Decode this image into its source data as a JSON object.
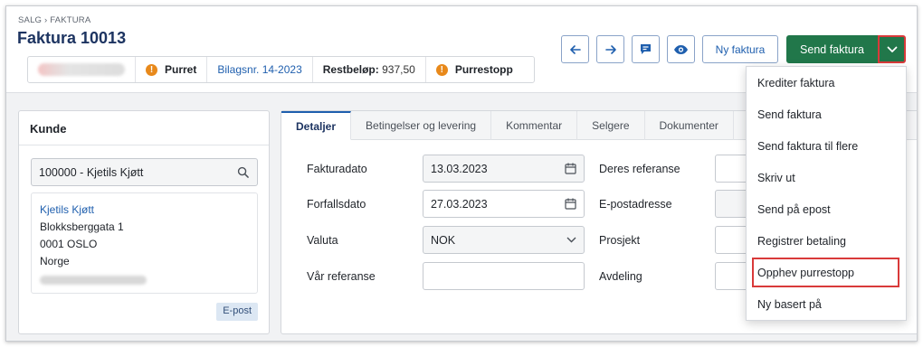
{
  "breadcrumb": "SALG › FAKTURA",
  "title": "Faktura 10013",
  "status": {
    "state": "Purret",
    "bilagsnr": "Bilagsnr. 14-2023",
    "restbelop_label": "Restbeløp:",
    "restbelop_value": "937,50",
    "purrestopp": "Purrestopp",
    "warn_color": "#e8891b"
  },
  "toolbar": {
    "prev_icon": "arrow-left-icon",
    "next_icon": "arrow-right-icon",
    "comment_icon": "comment-icon",
    "preview_icon": "eye-icon",
    "ny_faktura": "Ny faktura",
    "send_faktura": "Send faktura",
    "caret_icon": "chevron-down-icon",
    "send_color": "#21774a"
  },
  "kunde": {
    "heading": "Kunde",
    "search_value": "100000 - Kjetils Kjøtt",
    "name": "Kjetils Kjøtt",
    "street": "Blokksberggata 1",
    "postal": "0001 OSLO",
    "country": "Norge",
    "epost_tag": "E-post"
  },
  "tabs": [
    "Detaljer",
    "Betingelser og levering",
    "Kommentar",
    "Selgere",
    "Dokumenter"
  ],
  "form": {
    "fakturadato_label": "Fakturadato",
    "fakturadato_value": "13.03.2023",
    "forfallsdato_label": "Forfallsdato",
    "forfallsdato_value": "27.03.2023",
    "valuta_label": "Valuta",
    "valuta_value": "NOK",
    "var_referanse_label": "Vår referanse",
    "var_referanse_value": "",
    "deres_referanse_label": "Deres referanse",
    "epostadresse_label": "E-postadresse",
    "prosjekt_label": "Prosjekt",
    "avdeling_label": "Avdeling"
  },
  "menu": {
    "items": [
      "Krediter faktura",
      "Send faktura",
      "Send faktura til flere",
      "Skriv ut",
      "Send på epost",
      "Registrer betaling",
      "Opphev purrestopp",
      "Ny basert på"
    ],
    "highlighted": "Opphev purrestopp",
    "highlight_color": "#d93a3a"
  }
}
